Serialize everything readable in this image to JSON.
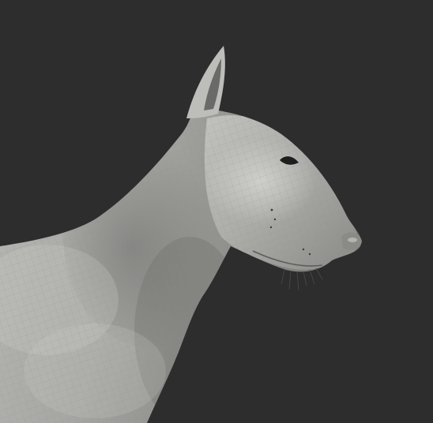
{
  "scene": {
    "subject": "sculpted-dog-model",
    "background_color": "#2d2d2d",
    "model_base_color": "#a3a3a0",
    "model_highlight_color": "#d2d2cf",
    "model_shadow_color": "#5f5f5d",
    "wireframe_color": "#8c8c89",
    "feature_color": "#1e1e1e"
  }
}
